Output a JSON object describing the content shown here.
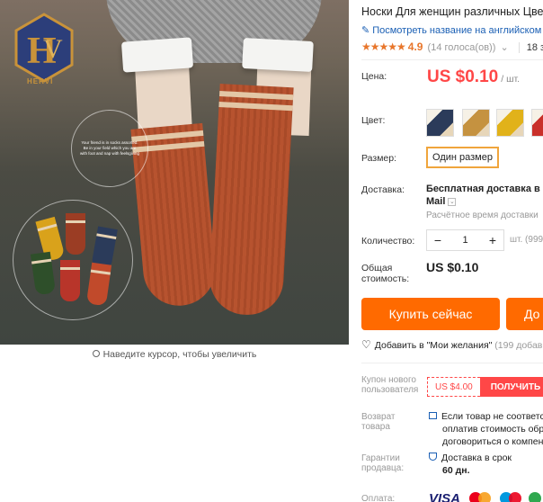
{
  "gallery": {
    "logo_text": "HERVİ",
    "circle_text": "Your friend is in socks assorted. Be in your field which you are with foot and nap with feelsgiving",
    "zoom_hint": "Наведите курсор, чтобы увеличить"
  },
  "product": {
    "title": "Носки Для женщин различных Цве",
    "translate_link": "Посмотреть название на английском",
    "rating_stars": "★★★★★",
    "rating_score": "4.9",
    "votes": "(14 голоса(ов))",
    "sold": "18 з"
  },
  "price": {
    "label": "Цена:",
    "value": "US $0.10",
    "unit": "/ шт."
  },
  "color": {
    "label": "Цвет:",
    "swatches": [
      "navy",
      "mustard",
      "yellow",
      "red",
      "red-dark"
    ]
  },
  "size": {
    "label": "Размер:",
    "selected": "Один размер"
  },
  "shipping": {
    "label": "Доставка:",
    "line1": "Бесплатная доставка в R",
    "line2": "Mail",
    "estimate": "Расчётное время доставки"
  },
  "quantity": {
    "label": "Количество:",
    "minus": "−",
    "value": "1",
    "plus": "+",
    "unit": "шт. (999"
  },
  "total": {
    "label_line1": "Общая",
    "label_line2": "стоимость:",
    "value": "US $0.10"
  },
  "actions": {
    "buy_now": "Купить сейчас",
    "add_to_cart": "До",
    "wishlist": "Добавить в \"Мои желания\"",
    "wishlist_count": "(199 добав"
  },
  "coupon": {
    "label_line1": "Купон нового",
    "label_line2": "пользователя",
    "amount": "US $4.00",
    "get": "ПОЛУЧИТЬ"
  },
  "returns": {
    "label_line1": "Возврат",
    "label_line2": "товара",
    "text_line1": "Если товар не соответс",
    "text_line2": "оплатив стоимость обр",
    "text_line3": "договориться о компен"
  },
  "guarantee": {
    "label_line1": "Гарантии",
    "label_line2": "продавца:",
    "text_line1": "Доставка в срок",
    "text_line2": "60 дн."
  },
  "payment": {
    "label": "Оплата:",
    "visa": "VISA"
  },
  "colors": {
    "accent": "#ff6a00",
    "price_red": "#ff4747",
    "link_blue": "#1a5fb4",
    "star_orange": "#e8762b",
    "size_border": "#f0a53c"
  }
}
